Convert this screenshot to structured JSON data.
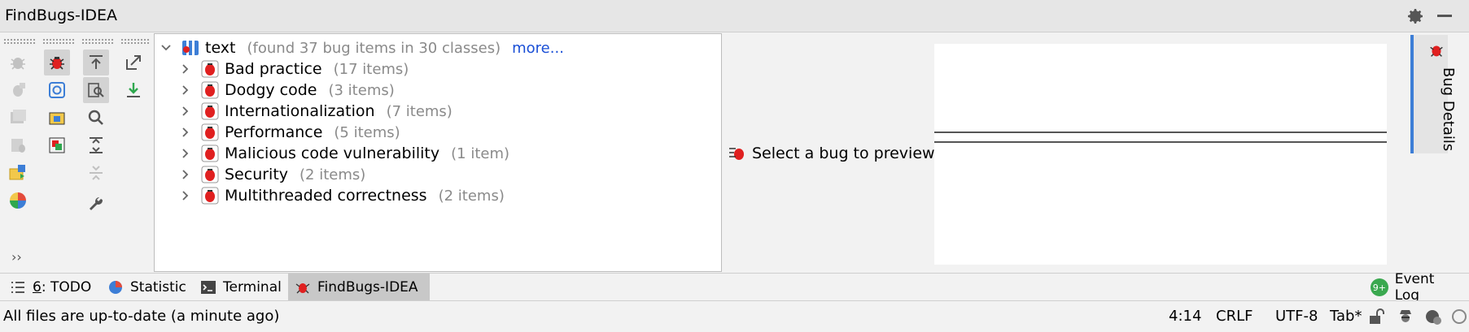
{
  "window": {
    "title": "FindBugs-IDEA"
  },
  "tree": {
    "root": {
      "label": "text",
      "summary": "(found 37 bug items in 30 classes)",
      "more": "more..."
    },
    "categories": [
      {
        "label": "Bad practice",
        "count": "(17 items)"
      },
      {
        "label": "Dodgy code",
        "count": "(3 items)"
      },
      {
        "label": "Internationalization",
        "count": "(7 items)"
      },
      {
        "label": "Performance",
        "count": "(5 items)"
      },
      {
        "label": "Malicious code vulnerability",
        "count": "(1 item)"
      },
      {
        "label": "Security",
        "count": "(2 items)"
      },
      {
        "label": "Multithreaded correctness",
        "count": "(2 items)"
      }
    ]
  },
  "preview": {
    "message": "Select a bug to preview"
  },
  "side_tab": {
    "label": "Bug Details"
  },
  "tool_windows": [
    {
      "mnemonic": "6",
      "label": ": TODO"
    },
    {
      "label": "Statistic"
    },
    {
      "label": "Terminal"
    },
    {
      "label": "FindBugs-IDEA"
    },
    {
      "badge": "9+",
      "label": "Event Log"
    }
  ],
  "status": {
    "message": "All files are up-to-date (a minute ago)",
    "position": "4:14",
    "line_separator": "CRLF",
    "encoding": "UTF-8",
    "indent": "Tab*"
  },
  "colors": {
    "accent": "#3d7ed6",
    "link": "#1a4fd6",
    "bug_red": "#e02020",
    "muted_text": "#8a8a8a"
  }
}
